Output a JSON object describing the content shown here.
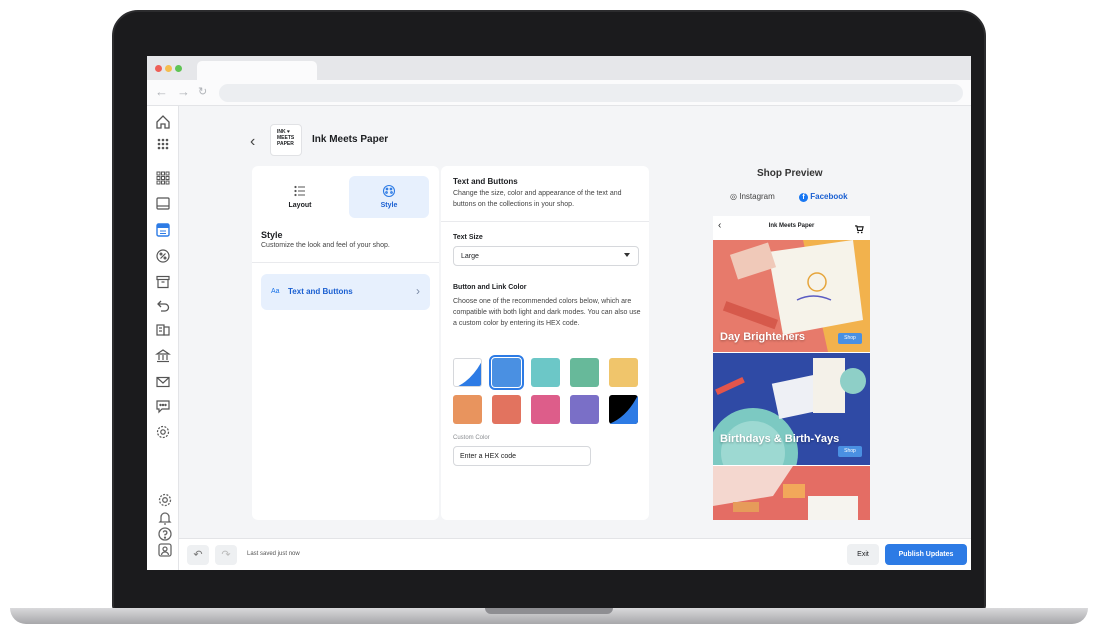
{
  "header": {
    "shop_logo_text": "INK ♥ MEETS PAPER",
    "shop_name": "Ink Meets Paper"
  },
  "mode_tabs": [
    {
      "label": "Layout",
      "active": false
    },
    {
      "label": "Style",
      "active": true
    }
  ],
  "style_panel": {
    "title": "Style",
    "subtitle": "Customize the look and feel of your shop.",
    "item_prefix": "Aa",
    "item_label": "Text and Buttons"
  },
  "settings": {
    "title": "Text and Buttons",
    "description": "Change the size, color and appearance of the text and buttons on the collections in your shop.",
    "text_size_label": "Text Size",
    "text_size_value": "Large",
    "color_title": "Button and Link Color",
    "color_description": "Choose one of the recommended colors below, which are compatible with both light and dark modes. You can also use a custom color by entering its HEX code.",
    "swatches": [
      "#ffffff/#2d7be5",
      "#4a90e2",
      "#6cc7c7",
      "#67b99a",
      "#f0c56b",
      "#e8945e",
      "#e2735f",
      "#dd5d8a",
      "#7a6fc7",
      "#000000/#2d7be5"
    ],
    "selected_swatch": 1,
    "custom_color_label": "Custom Color",
    "hex_value": "Enter a HEX code"
  },
  "preview": {
    "title": "Shop Preview",
    "tabs": [
      "Instagram",
      "Facebook"
    ],
    "active_tab": "Facebook",
    "phone_title": "Ink Meets Paper",
    "collections": [
      {
        "title": "Day Brighteners",
        "button": "Shop"
      },
      {
        "title": "Birthdays & Birth-Yays",
        "button": "Shop"
      }
    ]
  },
  "bottombar": {
    "saved_text": "Last saved just now",
    "exit_label": "Exit",
    "publish_label": "Publish Updates"
  },
  "colors": {
    "accent": "#2d7be5",
    "background": "#f4f5f7"
  }
}
